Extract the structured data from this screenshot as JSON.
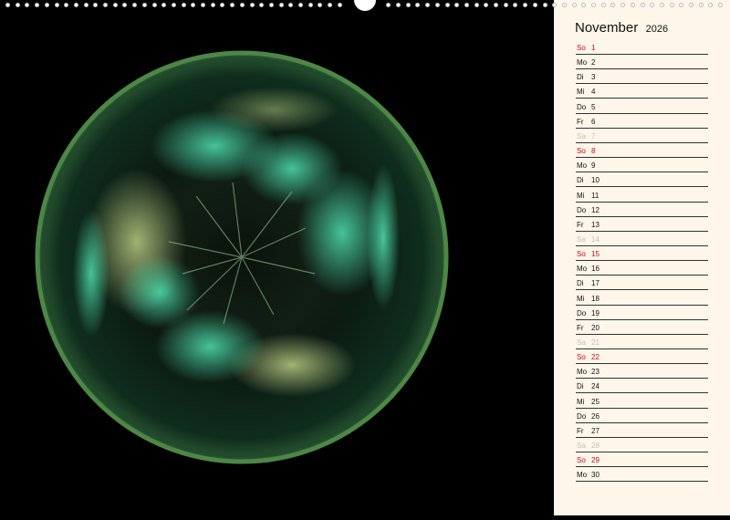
{
  "calendar": {
    "month": "November",
    "year": "2026",
    "days": [
      {
        "wd": "So",
        "num": "1",
        "kind": "sun"
      },
      {
        "wd": "Mo",
        "num": "2",
        "kind": "work"
      },
      {
        "wd": "Di",
        "num": "3",
        "kind": "work"
      },
      {
        "wd": "Mi",
        "num": "4",
        "kind": "work"
      },
      {
        "wd": "Do",
        "num": "5",
        "kind": "work"
      },
      {
        "wd": "Fr",
        "num": "6",
        "kind": "work"
      },
      {
        "wd": "Sa",
        "num": "7",
        "kind": "sat"
      },
      {
        "wd": "So",
        "num": "8",
        "kind": "sun"
      },
      {
        "wd": "Mo",
        "num": "9",
        "kind": "work"
      },
      {
        "wd": "Di",
        "num": "10",
        "kind": "work"
      },
      {
        "wd": "Mi",
        "num": "11",
        "kind": "work"
      },
      {
        "wd": "Do",
        "num": "12",
        "kind": "work"
      },
      {
        "wd": "Fr",
        "num": "13",
        "kind": "work"
      },
      {
        "wd": "Sa",
        "num": "14",
        "kind": "sat"
      },
      {
        "wd": "So",
        "num": "15",
        "kind": "sun"
      },
      {
        "wd": "Mo",
        "num": "16",
        "kind": "work"
      },
      {
        "wd": "Di",
        "num": "17",
        "kind": "work"
      },
      {
        "wd": "Mi",
        "num": "18",
        "kind": "work"
      },
      {
        "wd": "Do",
        "num": "19",
        "kind": "work"
      },
      {
        "wd": "Fr",
        "num": "20",
        "kind": "work"
      },
      {
        "wd": "Sa",
        "num": "21",
        "kind": "sat"
      },
      {
        "wd": "So",
        "num": "22",
        "kind": "sun"
      },
      {
        "wd": "Mo",
        "num": "23",
        "kind": "work"
      },
      {
        "wd": "Di",
        "num": "24",
        "kind": "work"
      },
      {
        "wd": "Mi",
        "num": "25",
        "kind": "work"
      },
      {
        "wd": "Do",
        "num": "26",
        "kind": "work"
      },
      {
        "wd": "Fr",
        "num": "27",
        "kind": "work"
      },
      {
        "wd": "Sa",
        "num": "28",
        "kind": "sat"
      },
      {
        "wd": "So",
        "num": "29",
        "kind": "sun"
      },
      {
        "wd": "Mo",
        "num": "30",
        "kind": "work"
      }
    ]
  },
  "colors": {
    "sunday": "#d0021b",
    "saturday": "#c4c0b8",
    "panel": "#fdf6e9",
    "orb_rim": "#4f8a48",
    "orb_glow": "#3fc29a"
  },
  "image": {
    "subject-icon": "green-glass-orb-icon"
  }
}
